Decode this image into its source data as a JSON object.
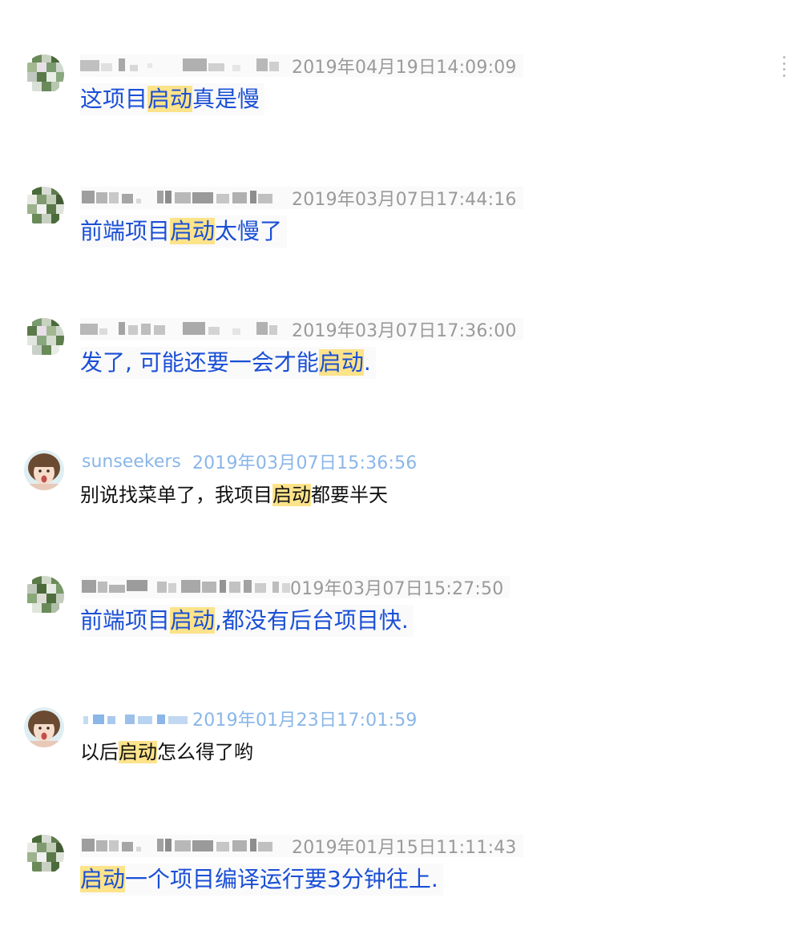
{
  "messages": [
    {
      "sender": "",
      "sender_blurred": true,
      "time": "2019年04月19日14:09:09",
      "text_before": "这项目",
      "highlight": "启动",
      "text_after": "真是慢",
      "style": "blue"
    },
    {
      "sender": "",
      "sender_blurred": true,
      "time": "2019年03月07日17:44:16",
      "text_before": "前端项目",
      "highlight": "启动",
      "text_after": "太慢了",
      "style": "blue"
    },
    {
      "sender": "",
      "sender_blurred": true,
      "time": "2019年03月07日17:36:00",
      "text_before": "发了, 可能还要一会才能",
      "highlight": "启动",
      "text_after": ".",
      "style": "blue"
    },
    {
      "sender": "sunseekers",
      "sender_blurred": false,
      "time": "2019年03月07日15:36:56",
      "text_before": "别说找菜单了，我项目",
      "highlight": "启动",
      "text_after": "都要半天",
      "style": "black"
    },
    {
      "sender": "",
      "sender_blurred": true,
      "time": "019年03月07日15:27:50",
      "text_before": "前端项目",
      "highlight": "启动",
      "text_after": ",都没有后台项目快.",
      "style": "blue"
    },
    {
      "sender": "",
      "sender_blurred": true,
      "time": "2019年01月23日17:01:59",
      "text_before": "以后",
      "highlight": "启动",
      "text_after": "怎么得了哟",
      "style": "black"
    },
    {
      "sender": "",
      "sender_blurred": true,
      "time": "2019年01月15日11:11:43",
      "text_before": "",
      "highlight": "启动",
      "text_after": "一个项目编译运行要3分钟往上.",
      "style": "blue"
    }
  ],
  "colors": {
    "message_blue": "#1a4fd6",
    "highlight": "#fde38a",
    "timestamp_gray": "#9a9a9a",
    "username_blue": "#8ab6e8"
  },
  "icons": {
    "more": "more-vertical-icon"
  }
}
